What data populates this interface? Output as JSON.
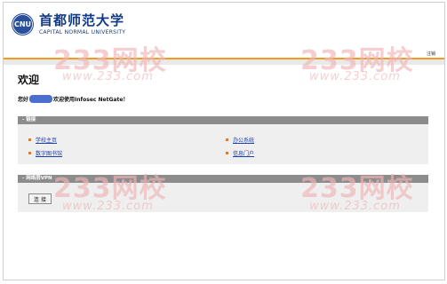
{
  "header": {
    "logo_seal_text": "CNU",
    "school_name_cn": "首都师范大学",
    "school_name_en": "CAPITAL NORMAL UNIVERSITY",
    "logout_label": "注销"
  },
  "main": {
    "title": "欢迎",
    "welcome_prefix": "您好",
    "welcome_suffix": "欢迎使用Infosec NetGate！"
  },
  "links_panel": {
    "title": "- 链接",
    "items": [
      {
        "label": "学校主页"
      },
      {
        "label": "数字图书馆"
      },
      {
        "label": "办公系统"
      },
      {
        "label": "信息门户"
      }
    ]
  },
  "vpn_panel": {
    "title": "- 网络层VPN",
    "connect_label": "连 接"
  },
  "watermark": {
    "big_text": "233网校",
    "small_text": "www.233.com"
  },
  "colors": {
    "accent_orange": "#f39a21",
    "link_blue": "#1c3fae",
    "panel_header": "#8c8c8c",
    "logo_blue": "#123a86"
  }
}
